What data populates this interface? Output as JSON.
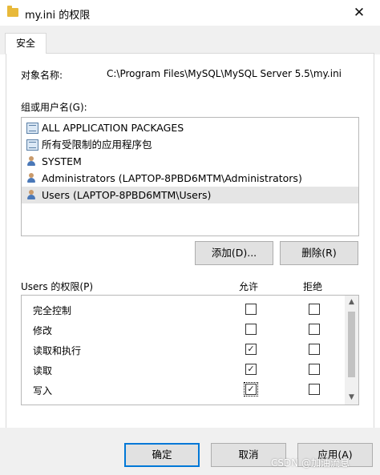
{
  "window": {
    "title": "my.ini 的权限",
    "close_glyph": "✕"
  },
  "tabs": [
    {
      "label": "安全"
    }
  ],
  "object": {
    "label": "对象名称:",
    "value": "C:\\Program Files\\MySQL\\MySQL Server 5.5\\my.ini"
  },
  "groups": {
    "label": "组或用户名(G):",
    "items": [
      {
        "label": "ALL APPLICATION PACKAGES",
        "icon": "package-icon"
      },
      {
        "label": "所有受限制的应用程序包",
        "icon": "package-icon"
      },
      {
        "label": "SYSTEM",
        "icon": "user-group-icon"
      },
      {
        "label": "Administrators (LAPTOP-8PBD6MTM\\Administrators)",
        "icon": "user-group-icon"
      },
      {
        "label": "Users (LAPTOP-8PBD6MTM\\Users)",
        "icon": "user-group-icon",
        "selected": true
      }
    ]
  },
  "buttons": {
    "add": "添加(D)...",
    "remove": "删除(R)",
    "ok": "确定",
    "cancel": "取消",
    "apply": "应用(A)"
  },
  "permissions": {
    "label": "Users 的权限(P)",
    "allow_header": "允许",
    "deny_header": "拒绝",
    "check_glyph": "✓",
    "rows": [
      {
        "name": "完全控制",
        "allow": false,
        "deny": false
      },
      {
        "name": "修改",
        "allow": false,
        "deny": false
      },
      {
        "name": "读取和执行",
        "allow": true,
        "deny": false
      },
      {
        "name": "读取",
        "allow": true,
        "deny": false
      },
      {
        "name": "写入",
        "allow": true,
        "deny": false
      }
    ]
  },
  "watermark": "CSDN @加油流息",
  "colors": {
    "accent": "#0078d7",
    "selection": "#e5e5e5",
    "folder": "#e8b93a"
  }
}
